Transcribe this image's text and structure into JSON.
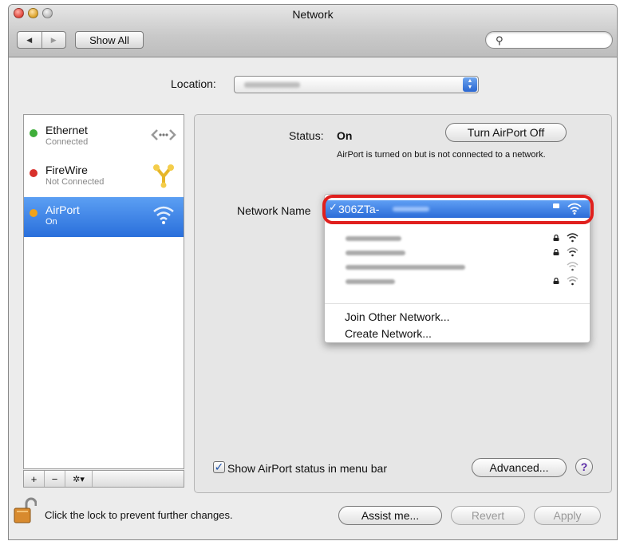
{
  "window": {
    "title": "Network"
  },
  "toolbar": {
    "show_all": "Show All",
    "back": "◀",
    "forward": "▶",
    "search_value": ""
  },
  "location": {
    "label": "Location:",
    "value": ""
  },
  "services": [
    {
      "name": "Ethernet",
      "status": "Connected",
      "dot_color": "#3fae3a",
      "icon": "ethernet-icon"
    },
    {
      "name": "FireWire",
      "status": "Not Connected",
      "dot_color": "#d8302b",
      "icon": "firewire-icon"
    },
    {
      "name": "AirPort",
      "status": "On",
      "dot_color": "#f0a21a",
      "icon": "wifi-icon"
    }
  ],
  "sidebar_actions": {
    "add": "+",
    "remove": "−",
    "gear": "✲▾"
  },
  "status": {
    "label": "Status:",
    "value": "On",
    "turn_off": "Turn AirPort Off",
    "description": "AirPort is turned on but is not connected to a network."
  },
  "network_name": {
    "label": "Network Name",
    "selected": "306ZTa-",
    "check": "✓"
  },
  "network_menu": {
    "others": [
      {
        "locked": true
      },
      {
        "locked": true
      },
      {
        "locked": false
      },
      {
        "locked": true
      }
    ],
    "join_other": "Join Other Network...",
    "create": "Create Network..."
  },
  "show_status": {
    "label": "Show AirPort status in menu bar",
    "checked": true,
    "check": "✓"
  },
  "buttons": {
    "advanced": "Advanced...",
    "help": "?",
    "assist": "Assist me...",
    "revert": "Revert",
    "apply": "Apply"
  },
  "lock": {
    "text": "Click the lock to prevent further changes."
  },
  "colors": {
    "selection": "#2c6cd8",
    "highlight_ring": "#e0201e"
  }
}
